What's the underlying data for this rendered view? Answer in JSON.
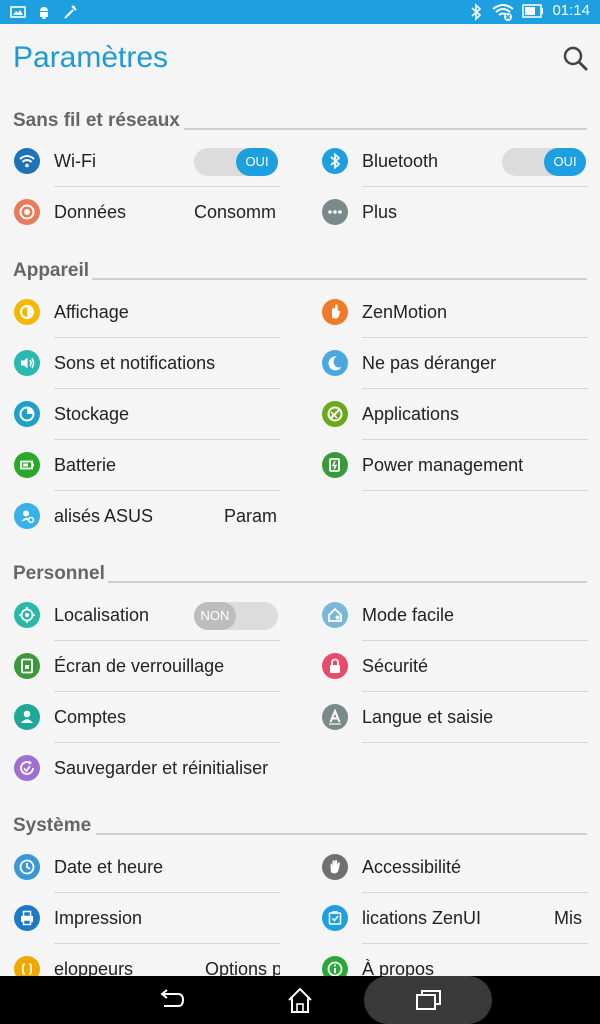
{
  "status_bar": {
    "time": "01:14"
  },
  "header": {
    "title": "Paramètres"
  },
  "sections": {
    "wireless": {
      "title": "Sans fil et réseaux",
      "wifi": {
        "label": "Wi-Fi",
        "toggle": "OUI"
      },
      "bluetooth": {
        "label": "Bluetooth",
        "toggle": "OUI"
      },
      "data": {
        "label": "Données",
        "sub": "Consomm"
      },
      "more": {
        "label": "Plus"
      }
    },
    "device": {
      "title": "Appareil",
      "display": {
        "label": "Affichage"
      },
      "zenmotion": {
        "label": "ZenMotion"
      },
      "sounds": {
        "label": "Sons et notifications"
      },
      "dnd": {
        "label": "Ne pas déranger"
      },
      "storage": {
        "label": "Stockage"
      },
      "apps": {
        "label": "Applications"
      },
      "battery": {
        "label": "Batterie"
      },
      "power": {
        "label": "Power management"
      },
      "asus": {
        "label": "alisés ASUS",
        "sub": "Param"
      }
    },
    "personal": {
      "title": "Personnel",
      "location": {
        "label": "Localisation",
        "toggle": "NON"
      },
      "easy_mode": {
        "label": "Mode facile"
      },
      "lockscreen": {
        "label": "Écran de verrouillage"
      },
      "security": {
        "label": "Sécurité"
      },
      "accounts": {
        "label": "Comptes"
      },
      "language": {
        "label": "Langue et saisie"
      },
      "backup": {
        "label": "Sauvegarder et réinitialiser"
      }
    },
    "system": {
      "title": "Système",
      "datetime": {
        "label": "Date et heure"
      },
      "accessibility": {
        "label": "Accessibilité"
      },
      "printing": {
        "label": "Impression"
      },
      "zenui": {
        "label": "lications ZenUI",
        "sub": "Mis"
      },
      "developer": {
        "label": "eloppeurs",
        "sub": "Options p"
      },
      "about": {
        "label": "À propos"
      }
    }
  },
  "colors": {
    "accent": "#1ea0e0",
    "wifi": "#1e72b8",
    "bluetooth": "#1ea0e0",
    "data": "#e97a5a",
    "more": "#7a8a8a",
    "display": "#f5b800",
    "zenmotion": "#ef7a2a",
    "sounds": "#2ab8b0",
    "dnd": "#4aa8e0",
    "storage": "#1ea0c8",
    "apps": "#6aaa1a",
    "battery": "#2aa82a",
    "power": "#3a9a3a",
    "asus": "#3ab0e8",
    "location": "#2ab8a8",
    "easy_mode": "#7ab8d8",
    "lockscreen": "#3a9a3a",
    "security": "#e84a6a",
    "accounts": "#1ea898",
    "language": "#7a8a8a",
    "backup": "#a070d0",
    "datetime": "#3a98d8",
    "accessibility": "#707070",
    "printing": "#1e78c8",
    "zenui": "#1ea0e0",
    "developer": "#f0a800",
    "about": "#2aa83a"
  }
}
